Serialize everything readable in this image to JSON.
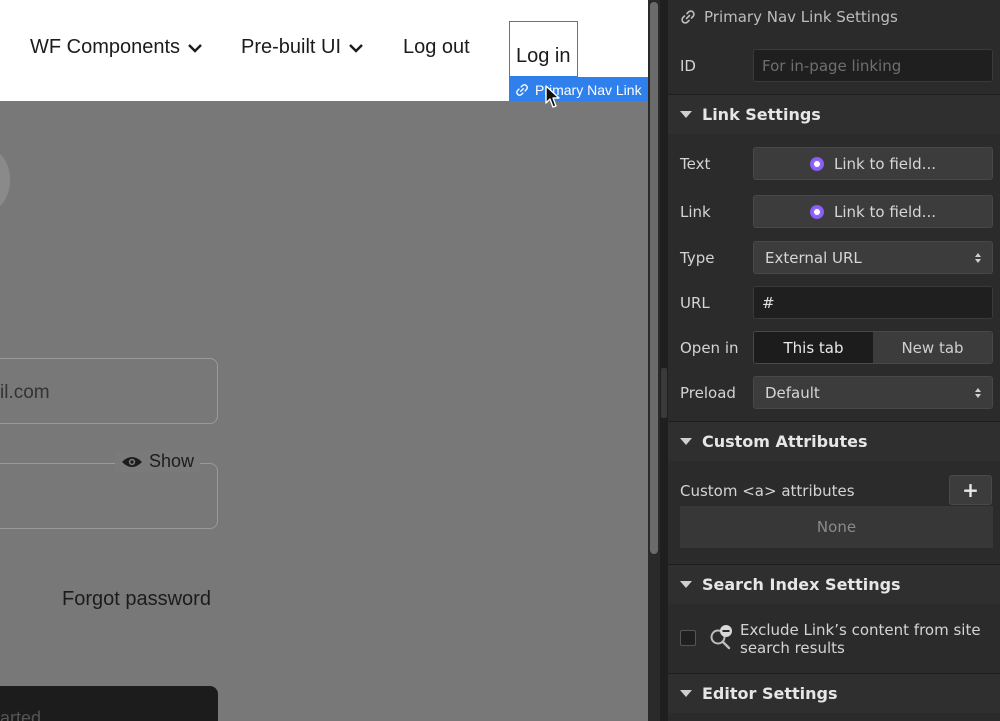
{
  "canvas": {
    "nav": {
      "components": "WF Components",
      "prebuilt": "Pre-built UI",
      "logout": "Log out",
      "login": "Log in"
    },
    "selection_tag": "Primary Nav Link",
    "email_value": "il.com",
    "show_label": "Show",
    "forgot_password": "Forgot password",
    "cta_label": "arted"
  },
  "panel": {
    "title": "Primary Nav Link Settings",
    "id": {
      "label": "ID",
      "placeholder": "For in-page linking"
    },
    "link_settings": {
      "heading": "Link Settings",
      "text_label": "Text",
      "text_value": "Link to field...",
      "link_label": "Link",
      "link_value": "Link to field...",
      "type_label": "Type",
      "type_value": "External URL",
      "url_label": "URL",
      "url_value": "#",
      "open_label": "Open in",
      "open_options": [
        "This tab",
        "New tab"
      ],
      "open_selected": "This tab",
      "preload_label": "Preload",
      "preload_value": "Default"
    },
    "custom_attributes": {
      "heading": "Custom Attributes",
      "label": "Custom <a> attributes",
      "add": "+",
      "empty": "None"
    },
    "search_index": {
      "heading": "Search Index Settings",
      "exclude_label": "Exclude Link’s content from site search results",
      "checked": false
    },
    "editor_settings": {
      "heading": "Editor Settings"
    }
  },
  "colors": {
    "selection_blue": "#2f80ed",
    "bind_purple": "#8b5cf6",
    "panel_bg": "#2b2b2b"
  }
}
